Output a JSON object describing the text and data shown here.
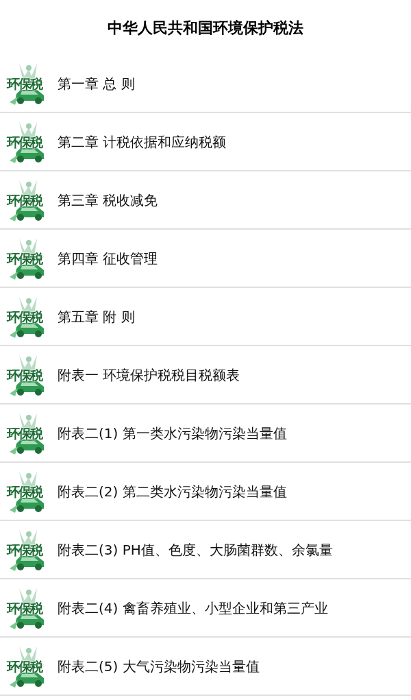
{
  "title": "中华人民共和国环境保护税法",
  "items": [
    {
      "logo": "环保税",
      "label": "第一章 总 则"
    },
    {
      "logo": "环保税",
      "label": "第二章 计税依据和应纳税额"
    },
    {
      "logo": "环保税",
      "label": "第三章 税收减免"
    },
    {
      "logo": "环保税",
      "label": "第四章 征收管理"
    },
    {
      "logo": "环保税",
      "label": "第五章 附 则"
    },
    {
      "logo": "环保税",
      "label": "附表一 环境保护税税目税额表"
    },
    {
      "logo": "环保税",
      "label": "附表二(1) 第一类水污染物污染当量值"
    },
    {
      "logo": "环保税",
      "label": "附表二(2) 第二类水污染物污染当量值"
    },
    {
      "logo": "环保税",
      "label": "附表二(3) PH值、色度、大肠菌群数、余氯量"
    },
    {
      "logo": "环保税",
      "label": "附表二(4) 禽畜养殖业、小型企业和第三产业"
    },
    {
      "logo": "环保税",
      "label": "附表二(5) 大气污染物污染当量值"
    }
  ]
}
